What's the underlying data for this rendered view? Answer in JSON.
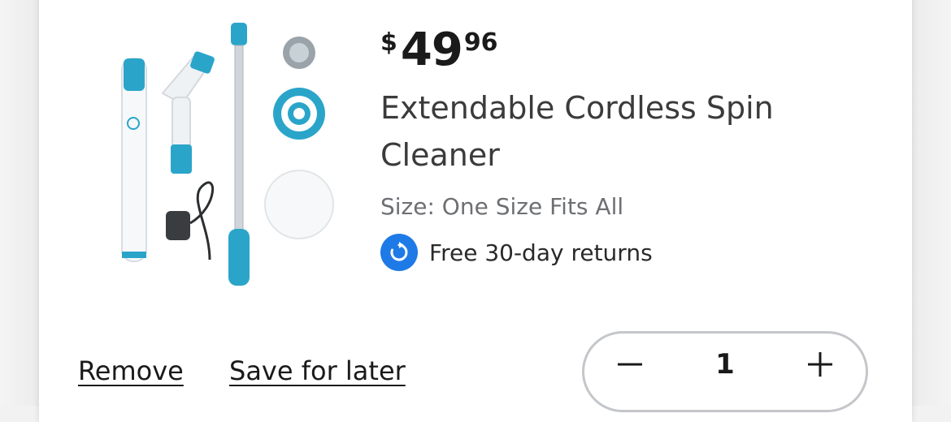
{
  "item": {
    "price": {
      "currency": "$",
      "dollars": "49",
      "cents": "96"
    },
    "title": "Extendable Cordless Spin Cleaner",
    "size_label": "Size: One Size Fits All",
    "returns_text": "Free 30-day returns",
    "product_image_icon": "spin-cleaner-product-image"
  },
  "actions": {
    "remove_label": "Remove",
    "save_label": "Save for later"
  },
  "quantity": {
    "value": "1",
    "minus_icon": "minus-icon",
    "plus_icon": "plus-icon"
  },
  "colors": {
    "accent_blue": "#1e7ae6",
    "teal": "#2aa5c9",
    "text_dark": "#1a1a1a",
    "text_muted": "#6d6f73",
    "border": "#c4c6ca"
  }
}
